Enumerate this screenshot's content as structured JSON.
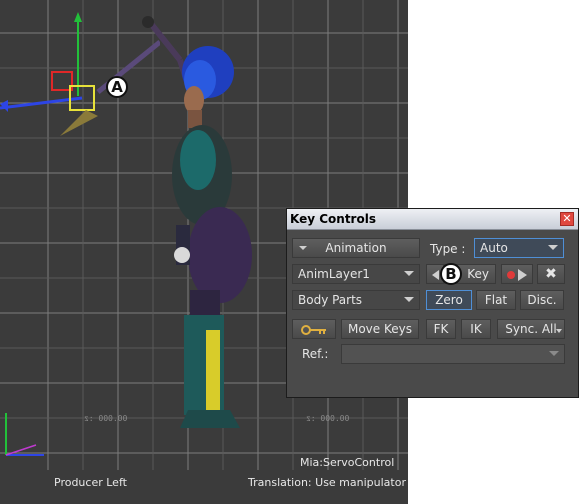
{
  "viewport": {
    "camera_name": "Producer Left",
    "character_name": "Mia:ServoControl",
    "status_text": "Translation: Use manipulator",
    "grid_numbers": [
      "00.000 :z",
      "00.000 :z"
    ],
    "callout_a": "A",
    "callout_b": "B"
  },
  "key_controls": {
    "title": "Key Controls",
    "close_label": "✕",
    "animation_button": "Animation",
    "type_label": "Type :",
    "type_value": "Auto",
    "layer_value": "AnimLayer1",
    "key_button": "Key",
    "clear_label": "✖",
    "body_parts_value": "Body Parts",
    "zero_button": "Zero",
    "flat_button": "Flat",
    "disc_button": "Disc.",
    "move_keys_button": "Move Keys",
    "fk_button": "FK",
    "ik_button": "IK",
    "sync_all_button": "Sync. All",
    "ref_label": "Ref.:",
    "ref_value": ""
  },
  "colors": {
    "viewport_bg": "#3b3b3b",
    "grid_line": "#7a7a7a",
    "panel_bg": "#4a4a4a",
    "highlight_border": "#4f8fd6",
    "record_red": "#e03a3a",
    "close_red": "#e0483f"
  }
}
